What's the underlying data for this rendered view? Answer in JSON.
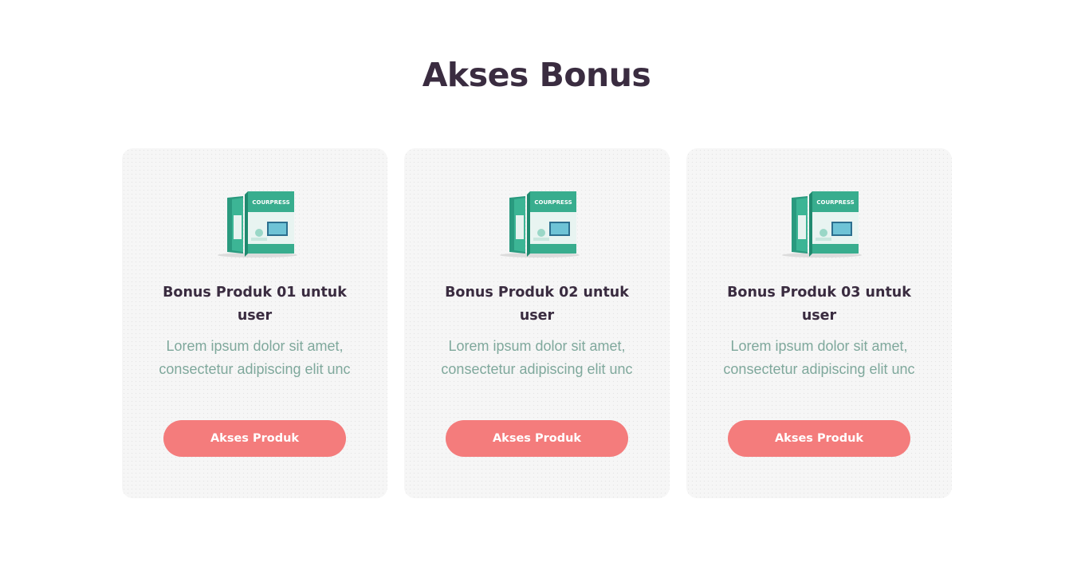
{
  "section": {
    "title": "Akses Bonus"
  },
  "colors": {
    "title": "#3a2c40",
    "text": "#7fa89c",
    "button": "#f47c7c",
    "card_bg": "#f6f6f6",
    "box": "#2fa88a"
  },
  "cards": [
    {
      "image_label": "COURPRESS",
      "title": "Bonus Produk 01 untuk user",
      "description": "Lorem ipsum dolor sit amet, consectetur adipiscing elit unc",
      "button_label": "Akses Produk"
    },
    {
      "image_label": "COURPRESS",
      "title": "Bonus Produk 02 untuk user",
      "description": "Lorem ipsum dolor sit amet, consectetur adipiscing elit unc",
      "button_label": "Akses Produk"
    },
    {
      "image_label": "COURPRESS",
      "title": "Bonus Produk 03 untuk user",
      "description": "Lorem ipsum dolor sit amet, consectetur adipiscing elit unc",
      "button_label": "Akses Produk"
    }
  ]
}
